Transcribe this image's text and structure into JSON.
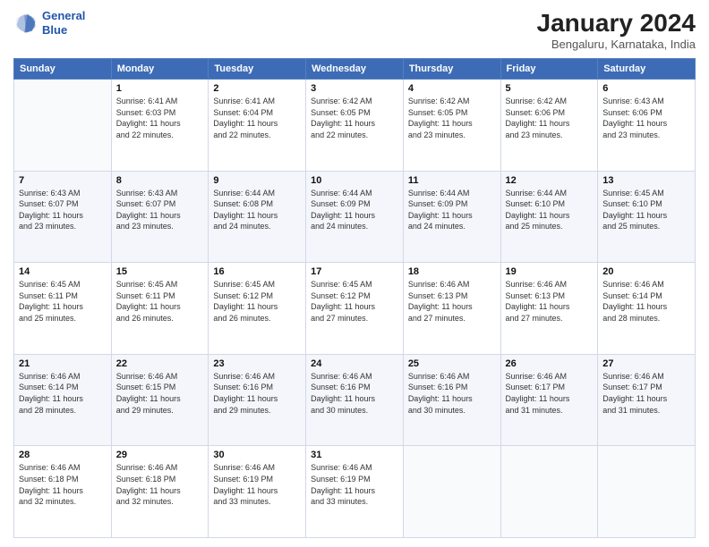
{
  "logo": {
    "line1": "General",
    "line2": "Blue"
  },
  "title": "January 2024",
  "subtitle": "Bengaluru, Karnataka, India",
  "days_of_week": [
    "Sunday",
    "Monday",
    "Tuesday",
    "Wednesday",
    "Thursday",
    "Friday",
    "Saturday"
  ],
  "weeks": [
    [
      {
        "day": "",
        "info": ""
      },
      {
        "day": "1",
        "info": "Sunrise: 6:41 AM\nSunset: 6:03 PM\nDaylight: 11 hours\nand 22 minutes."
      },
      {
        "day": "2",
        "info": "Sunrise: 6:41 AM\nSunset: 6:04 PM\nDaylight: 11 hours\nand 22 minutes."
      },
      {
        "day": "3",
        "info": "Sunrise: 6:42 AM\nSunset: 6:05 PM\nDaylight: 11 hours\nand 22 minutes."
      },
      {
        "day": "4",
        "info": "Sunrise: 6:42 AM\nSunset: 6:05 PM\nDaylight: 11 hours\nand 23 minutes."
      },
      {
        "day": "5",
        "info": "Sunrise: 6:42 AM\nSunset: 6:06 PM\nDaylight: 11 hours\nand 23 minutes."
      },
      {
        "day": "6",
        "info": "Sunrise: 6:43 AM\nSunset: 6:06 PM\nDaylight: 11 hours\nand 23 minutes."
      }
    ],
    [
      {
        "day": "7",
        "info": "Sunrise: 6:43 AM\nSunset: 6:07 PM\nDaylight: 11 hours\nand 23 minutes."
      },
      {
        "day": "8",
        "info": "Sunrise: 6:43 AM\nSunset: 6:07 PM\nDaylight: 11 hours\nand 23 minutes."
      },
      {
        "day": "9",
        "info": "Sunrise: 6:44 AM\nSunset: 6:08 PM\nDaylight: 11 hours\nand 24 minutes."
      },
      {
        "day": "10",
        "info": "Sunrise: 6:44 AM\nSunset: 6:09 PM\nDaylight: 11 hours\nand 24 minutes."
      },
      {
        "day": "11",
        "info": "Sunrise: 6:44 AM\nSunset: 6:09 PM\nDaylight: 11 hours\nand 24 minutes."
      },
      {
        "day": "12",
        "info": "Sunrise: 6:44 AM\nSunset: 6:10 PM\nDaylight: 11 hours\nand 25 minutes."
      },
      {
        "day": "13",
        "info": "Sunrise: 6:45 AM\nSunset: 6:10 PM\nDaylight: 11 hours\nand 25 minutes."
      }
    ],
    [
      {
        "day": "14",
        "info": "Sunrise: 6:45 AM\nSunset: 6:11 PM\nDaylight: 11 hours\nand 25 minutes."
      },
      {
        "day": "15",
        "info": "Sunrise: 6:45 AM\nSunset: 6:11 PM\nDaylight: 11 hours\nand 26 minutes."
      },
      {
        "day": "16",
        "info": "Sunrise: 6:45 AM\nSunset: 6:12 PM\nDaylight: 11 hours\nand 26 minutes."
      },
      {
        "day": "17",
        "info": "Sunrise: 6:45 AM\nSunset: 6:12 PM\nDaylight: 11 hours\nand 27 minutes."
      },
      {
        "day": "18",
        "info": "Sunrise: 6:46 AM\nSunset: 6:13 PM\nDaylight: 11 hours\nand 27 minutes."
      },
      {
        "day": "19",
        "info": "Sunrise: 6:46 AM\nSunset: 6:13 PM\nDaylight: 11 hours\nand 27 minutes."
      },
      {
        "day": "20",
        "info": "Sunrise: 6:46 AM\nSunset: 6:14 PM\nDaylight: 11 hours\nand 28 minutes."
      }
    ],
    [
      {
        "day": "21",
        "info": "Sunrise: 6:46 AM\nSunset: 6:14 PM\nDaylight: 11 hours\nand 28 minutes."
      },
      {
        "day": "22",
        "info": "Sunrise: 6:46 AM\nSunset: 6:15 PM\nDaylight: 11 hours\nand 29 minutes."
      },
      {
        "day": "23",
        "info": "Sunrise: 6:46 AM\nSunset: 6:16 PM\nDaylight: 11 hours\nand 29 minutes."
      },
      {
        "day": "24",
        "info": "Sunrise: 6:46 AM\nSunset: 6:16 PM\nDaylight: 11 hours\nand 30 minutes."
      },
      {
        "day": "25",
        "info": "Sunrise: 6:46 AM\nSunset: 6:16 PM\nDaylight: 11 hours\nand 30 minutes."
      },
      {
        "day": "26",
        "info": "Sunrise: 6:46 AM\nSunset: 6:17 PM\nDaylight: 11 hours\nand 31 minutes."
      },
      {
        "day": "27",
        "info": "Sunrise: 6:46 AM\nSunset: 6:17 PM\nDaylight: 11 hours\nand 31 minutes."
      }
    ],
    [
      {
        "day": "28",
        "info": "Sunrise: 6:46 AM\nSunset: 6:18 PM\nDaylight: 11 hours\nand 32 minutes."
      },
      {
        "day": "29",
        "info": "Sunrise: 6:46 AM\nSunset: 6:18 PM\nDaylight: 11 hours\nand 32 minutes."
      },
      {
        "day": "30",
        "info": "Sunrise: 6:46 AM\nSunset: 6:19 PM\nDaylight: 11 hours\nand 33 minutes."
      },
      {
        "day": "31",
        "info": "Sunrise: 6:46 AM\nSunset: 6:19 PM\nDaylight: 11 hours\nand 33 minutes."
      },
      {
        "day": "",
        "info": ""
      },
      {
        "day": "",
        "info": ""
      },
      {
        "day": "",
        "info": ""
      }
    ]
  ]
}
